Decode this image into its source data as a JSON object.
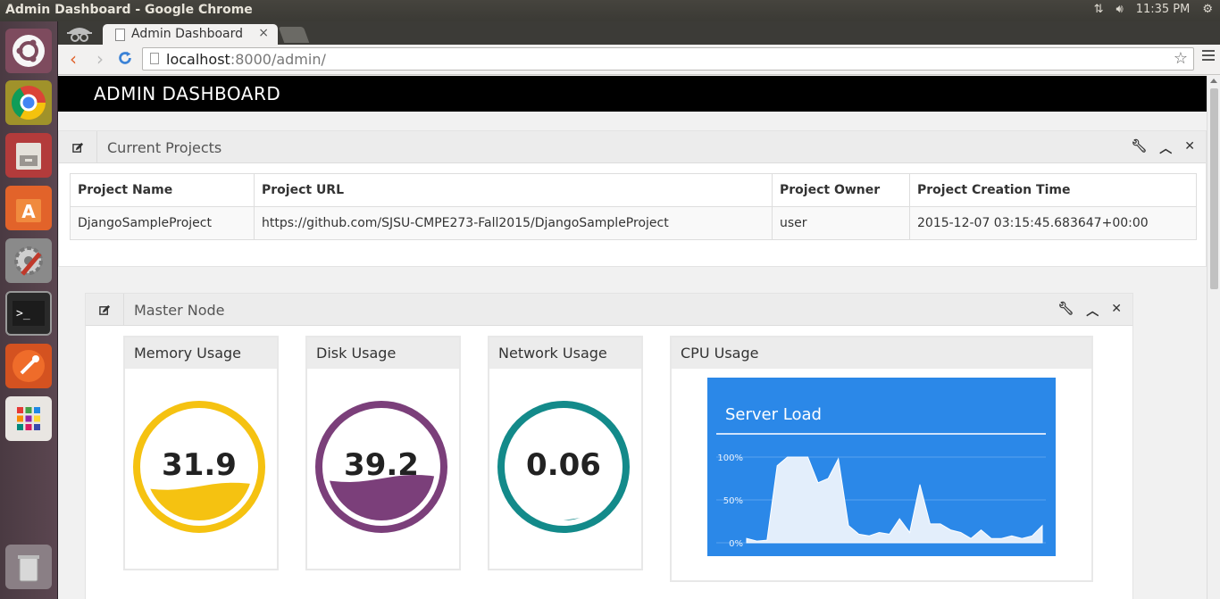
{
  "os": {
    "window_title": "Admin Dashboard - Google Chrome",
    "clock": "11:35 PM"
  },
  "browser": {
    "tab_title": "Admin Dashboard",
    "url_host": "localhost",
    "url_rest": ":8000/admin/"
  },
  "app": {
    "header_title": "ADMIN DASHBOARD"
  },
  "projects_widget": {
    "title": "Current Projects",
    "columns": [
      "Project Name",
      "Project URL",
      "Project Owner",
      "Project Creation Time"
    ],
    "rows": [
      [
        "DjangoSampleProject",
        "https://github.com/SJSU-CMPE273-Fall2015/DjangoSampleProject",
        "user",
        "2015-12-07 03:15:45.683647+00:00"
      ]
    ]
  },
  "master_widget": {
    "title": "Master Node",
    "memory": {
      "label": "Memory Usage",
      "value": "31.9",
      "fill": 0.319,
      "color": "#f5c211"
    },
    "disk": {
      "label": "Disk Usage",
      "value": "39.2",
      "fill": 0.392,
      "color": "#7b3f7a"
    },
    "network": {
      "label": "Network Usage",
      "value": "0.06",
      "fill": 0.0006,
      "color": "#138a8a"
    },
    "cpu": {
      "label": "CPU Usage"
    }
  },
  "chart_data": {
    "type": "area",
    "title": "Server Load",
    "ylabel": "",
    "xlabel": "",
    "y_ticks": [
      "100%",
      "50%",
      "0%"
    ],
    "ylim": [
      0,
      100
    ],
    "values": [
      5,
      2,
      3,
      90,
      100,
      100,
      100,
      70,
      75,
      98,
      20,
      10,
      8,
      12,
      10,
      28,
      12,
      68,
      22,
      22,
      15,
      12,
      5,
      15,
      5,
      5,
      8,
      5,
      8,
      20
    ],
    "grid": true,
    "background": "#2b88e8"
  }
}
